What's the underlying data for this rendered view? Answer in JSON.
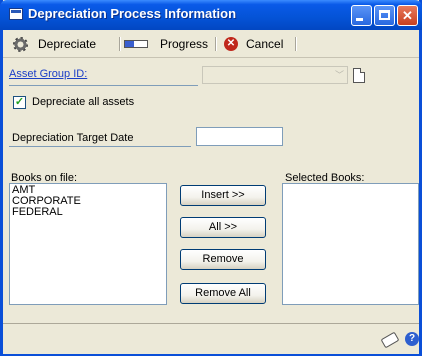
{
  "window": {
    "title": "Depreciation Process Information"
  },
  "toolbar": {
    "depreciate_label": "Depreciate",
    "progress_label": "Progress",
    "cancel_label": "Cancel"
  },
  "form": {
    "asset_group_label": "Asset Group ID:",
    "asset_group_value": "",
    "depreciate_all_label": "Depreciate all assets",
    "depreciate_all_checked": true,
    "target_date_label": "Depreciation Target Date",
    "target_date_value": "",
    "books_on_file_label": "Books on file:",
    "selected_books_label": "Selected Books:",
    "books_on_file": [
      "AMT",
      "CORPORATE",
      "FEDERAL"
    ],
    "selected_books": []
  },
  "buttons": {
    "insert": "Insert >>",
    "all": "All >>",
    "remove": "Remove",
    "remove_all": "Remove All"
  },
  "icons": {
    "toolbar": [
      "gear-icon",
      "progress-bar-icon",
      "cancel-icon"
    ],
    "status": [
      "note-icon",
      "help-icon"
    ]
  }
}
